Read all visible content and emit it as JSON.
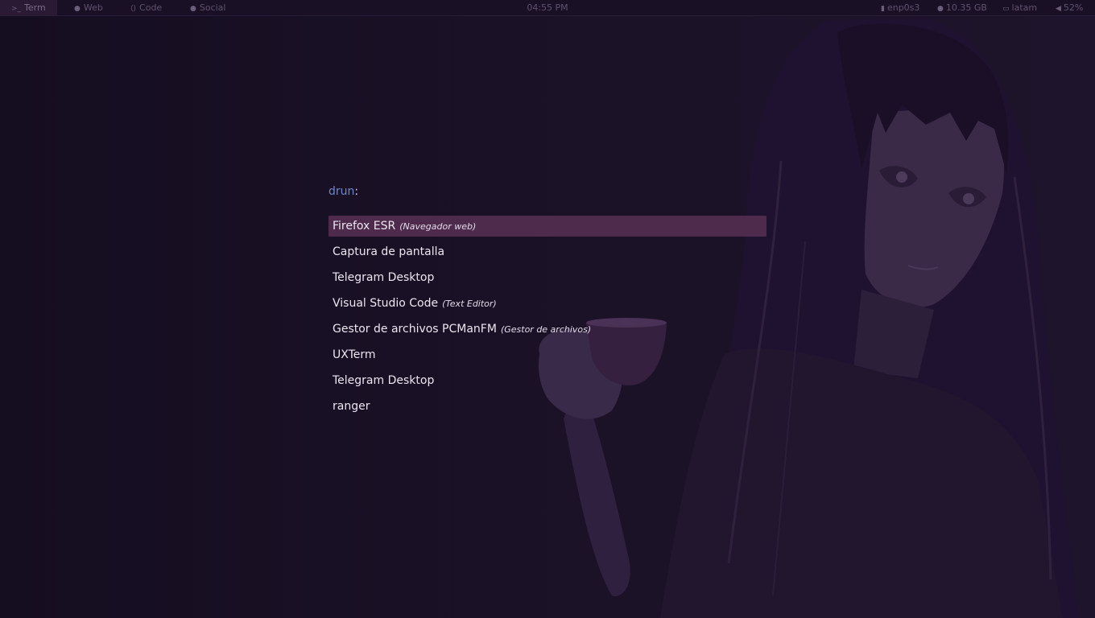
{
  "topbar": {
    "workspaces": [
      {
        "label": "Term",
        "icon": "terminal-icon",
        "active": true
      },
      {
        "label": "Web",
        "icon": "firefox-icon",
        "active": false
      },
      {
        "label": "Code",
        "icon": "vscode-icon",
        "active": false
      },
      {
        "label": "Social",
        "icon": "chat-icon",
        "active": false
      }
    ],
    "clock": "04:55 PM",
    "status": {
      "network": "enp0s3",
      "memory": "10.35 GB",
      "keyboard": "latam",
      "volume": "52%"
    }
  },
  "launcher": {
    "mode": "drun",
    "separator": ":",
    "entries": [
      {
        "name": "Firefox ESR",
        "generic": "(Navegador web)",
        "selected": true
      },
      {
        "name": "Captura de pantalla",
        "generic": ""
      },
      {
        "name": "Telegram Desktop",
        "generic": ""
      },
      {
        "name": "Visual Studio Code",
        "generic": "(Text Editor)"
      },
      {
        "name": "Gestor de archivos PCManFM",
        "generic": "(Gestor de archivos)"
      },
      {
        "name": "UXTerm",
        "generic": ""
      },
      {
        "name": "Telegram Desktop",
        "generic": ""
      },
      {
        "name": "ranger",
        "generic": ""
      }
    ]
  },
  "colors": {
    "background": "#170f22",
    "selection": "#4e2a4c",
    "prompt_accent": "#6f86c8",
    "text": "#ece6f0"
  }
}
